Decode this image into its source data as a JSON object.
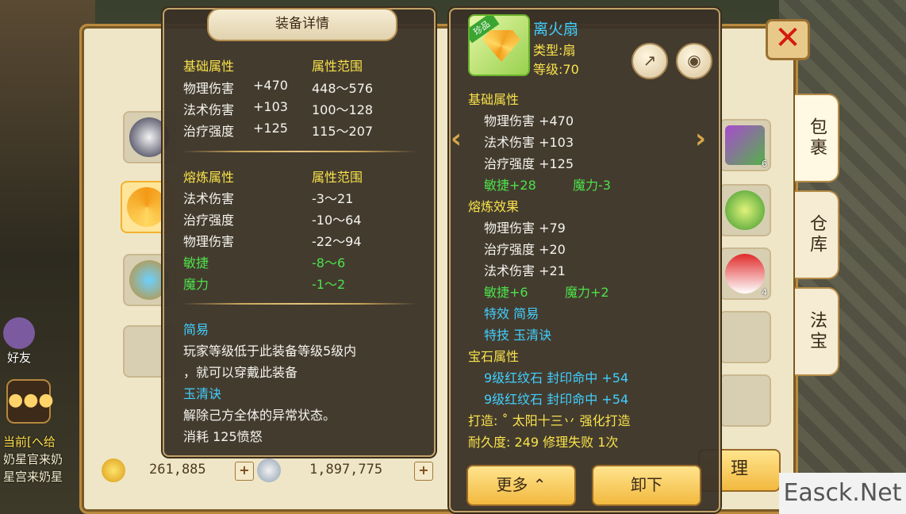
{
  "bag_tabs": [
    "包裹",
    "仓库",
    "法宝"
  ],
  "close_label": "✕",
  "currency": {
    "gold": "261,885",
    "silver": "1,897,775",
    "plus": "+"
  },
  "bottom_button": "理",
  "watermark": "Easck.Net",
  "hud": {
    "friend": "好友",
    "chat_lines": [
      "当前[へ给",
      "奶星官来奶",
      "星宫来奶星"
    ]
  },
  "slot_counts": [
    "6",
    "4"
  ],
  "detail_panel": {
    "title": "装备详情",
    "base": {
      "header": "基础属性",
      "range_header": "属性范围",
      "rows": [
        {
          "name": "物理伤害",
          "value": "+470",
          "range": "448～576"
        },
        {
          "name": "法术伤害",
          "value": "+103",
          "range": "100～128"
        },
        {
          "name": "治疗强度",
          "value": "+125",
          "range": "115～207"
        }
      ]
    },
    "smelt": {
      "header": "熔炼属性",
      "range_header": "属性范围",
      "rows": [
        {
          "name": "法术伤害",
          "range": "-3～21",
          "color": "white"
        },
        {
          "name": "治疗强度",
          "range": "-10～64",
          "color": "white"
        },
        {
          "name": "物理伤害",
          "range": "-22～94",
          "color": "white"
        },
        {
          "name": "敏捷",
          "range": "-8～6",
          "color": "green"
        },
        {
          "name": "魔力",
          "range": "-1～2",
          "color": "green"
        }
      ]
    },
    "effect_name": "简易",
    "effect_desc_1": "玩家等级低于此装备等级5级内",
    "effect_desc_2": "，就可以穿戴此装备",
    "skill_name": "玉清诀",
    "skill_desc": "解除己方全体的异常状态。",
    "skill_cost": "消耗  125愤怒"
  },
  "item_panel": {
    "tag": "珍品",
    "name": "离火扇",
    "type": "类型:扇",
    "level": "等级:70",
    "base_header": "基础属性",
    "base_rows": [
      "物理伤害 +470",
      "法术伤害 +103",
      "治疗强度 +125"
    ],
    "base_extra_1": "敏捷+28",
    "base_extra_2": "魔力-3",
    "smelt_header": "熔炼效果",
    "smelt_rows": [
      "物理伤害 +79",
      "治疗强度 +20",
      "法术伤害 +21"
    ],
    "smelt_extra_1": "敏捷+6",
    "smelt_extra_2": "魔力+2",
    "special_effect": "特效  简易",
    "special_skill": "特技  玉清诀",
    "gem_header": "宝石属性",
    "gem_rows": [
      "9级红纹石  封印命中 +54",
      "9级红纹石  封印命中 +54"
    ],
    "forge": "打造: ˚ 太阳十三丷   强化打造",
    "durability": "耐久度: 249  修理失败 1次",
    "more_button": "更多",
    "unequip_button": "卸下",
    "share_icon": "share-icon",
    "eye_icon": "eye-icon"
  }
}
